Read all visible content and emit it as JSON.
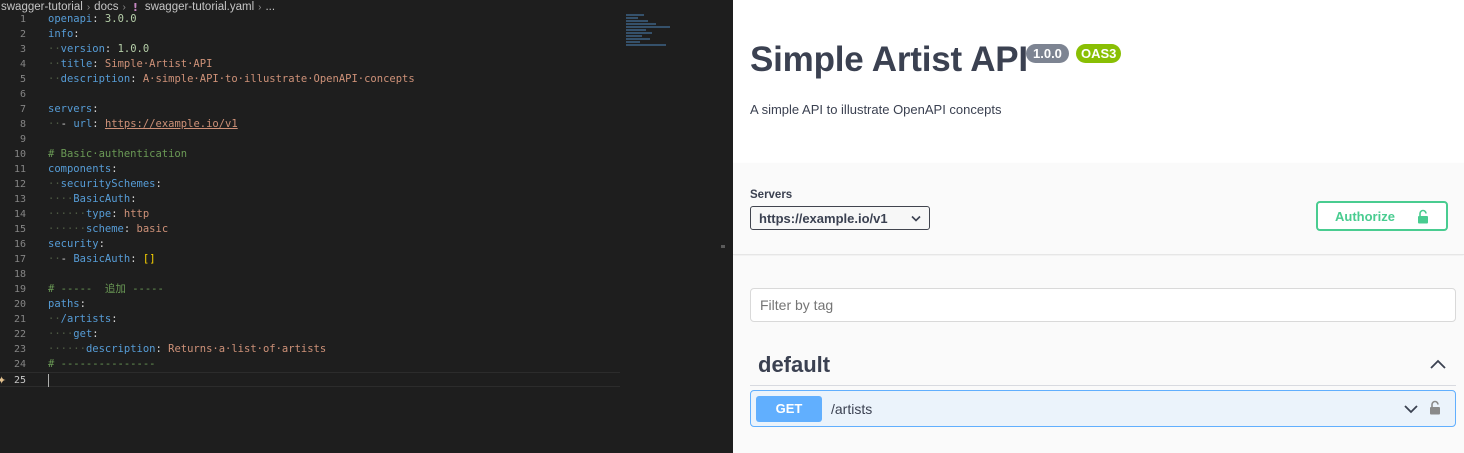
{
  "breadcrumb": [
    "swagger-tutorial",
    "docs",
    "swagger-tutorial.yaml",
    "..."
  ],
  "editor": {
    "lines": [
      {
        "n": "1",
        "segs": [
          [
            "k",
            "openapi"
          ],
          [
            "p",
            ": "
          ],
          [
            "n",
            "3.0.0"
          ]
        ]
      },
      {
        "n": "2",
        "segs": [
          [
            "k",
            "info"
          ],
          [
            "p",
            ":"
          ]
        ]
      },
      {
        "n": "3",
        "segs": [
          [
            "ws",
            "··"
          ],
          [
            "k",
            "version"
          ],
          [
            "p",
            ": "
          ],
          [
            "n",
            "1.0.0"
          ]
        ]
      },
      {
        "n": "4",
        "segs": [
          [
            "ws",
            "··"
          ],
          [
            "k",
            "title"
          ],
          [
            "p",
            ": "
          ],
          [
            "s",
            "Simple·Artist·API"
          ]
        ]
      },
      {
        "n": "5",
        "segs": [
          [
            "ws",
            "··"
          ],
          [
            "k",
            "description"
          ],
          [
            "p",
            ": "
          ],
          [
            "s",
            "A·simple·API·to·illustrate·OpenAPI·concepts"
          ]
        ]
      },
      {
        "n": "6",
        "segs": []
      },
      {
        "n": "7",
        "segs": [
          [
            "k",
            "servers"
          ],
          [
            "p",
            ":"
          ]
        ]
      },
      {
        "n": "8",
        "segs": [
          [
            "ws",
            "··"
          ],
          [
            "p",
            "- "
          ],
          [
            "k",
            "url"
          ],
          [
            "p",
            ": "
          ],
          [
            "u",
            "https://example.io/v1"
          ]
        ]
      },
      {
        "n": "9",
        "segs": []
      },
      {
        "n": "10",
        "segs": [
          [
            "c",
            "# Basic·authentication"
          ]
        ]
      },
      {
        "n": "11",
        "segs": [
          [
            "k",
            "components"
          ],
          [
            "p",
            ":"
          ]
        ]
      },
      {
        "n": "12",
        "segs": [
          [
            "ws",
            "··"
          ],
          [
            "k",
            "securitySchemes"
          ],
          [
            "p",
            ":"
          ]
        ]
      },
      {
        "n": "13",
        "segs": [
          [
            "ws",
            "····"
          ],
          [
            "k",
            "BasicAuth"
          ],
          [
            "p",
            ":"
          ]
        ]
      },
      {
        "n": "14",
        "segs": [
          [
            "ws",
            "······"
          ],
          [
            "k",
            "type"
          ],
          [
            "p",
            ": "
          ],
          [
            "s",
            "http"
          ]
        ]
      },
      {
        "n": "15",
        "segs": [
          [
            "ws",
            "······"
          ],
          [
            "k",
            "scheme"
          ],
          [
            "p",
            ": "
          ],
          [
            "s",
            "basic"
          ]
        ]
      },
      {
        "n": "16",
        "segs": [
          [
            "k",
            "security"
          ],
          [
            "p",
            ":"
          ]
        ]
      },
      {
        "n": "17",
        "segs": [
          [
            "ws",
            "··"
          ],
          [
            "p",
            "- "
          ],
          [
            "k",
            "BasicAuth"
          ],
          [
            "p",
            ": "
          ],
          [
            "br",
            "[]"
          ]
        ]
      },
      {
        "n": "18",
        "segs": []
      },
      {
        "n": "19",
        "segs": [
          [
            "c",
            "# -----  追加 -----"
          ]
        ]
      },
      {
        "n": "20",
        "segs": [
          [
            "k",
            "paths"
          ],
          [
            "p",
            ":"
          ]
        ]
      },
      {
        "n": "21",
        "segs": [
          [
            "ws",
            "··"
          ],
          [
            "k",
            "/artists"
          ],
          [
            "p",
            ":"
          ]
        ]
      },
      {
        "n": "22",
        "segs": [
          [
            "ws",
            "····"
          ],
          [
            "k",
            "get"
          ],
          [
            "p",
            ":"
          ]
        ]
      },
      {
        "n": "23",
        "segs": [
          [
            "ws",
            "······"
          ],
          [
            "k",
            "description"
          ],
          [
            "p",
            ": "
          ],
          [
            "s",
            "Returns·a·list·of·artists"
          ]
        ]
      },
      {
        "n": "24",
        "segs": [
          [
            "c",
            "# ---------------"
          ]
        ]
      },
      {
        "n": "25",
        "segs": [],
        "active": true
      }
    ]
  },
  "swagger": {
    "title": "Simple Artist API",
    "version": "1.0.0",
    "oas_badge": "OAS3",
    "description": "A simple API to illustrate OpenAPI concepts",
    "servers_label": "Servers",
    "server_selected": "https://example.io/v1",
    "authorize_label": "Authorize",
    "filter_placeholder": "Filter by tag",
    "tag_name": "default",
    "operation": {
      "method": "GET",
      "path": "/artists"
    }
  },
  "colors": {
    "get": "#61affe",
    "authorize": "#49cc90",
    "oas": "#89bf04",
    "version": "#7d8492"
  },
  "icons": {
    "yaml_file": "exclamation-icon",
    "server_chevron": "chevron-down-icon",
    "authorize_lock": "lock-icon",
    "tag_toggle": "chevron-up-icon",
    "op_chevron": "chevron-down-icon",
    "op_lock": "lock-icon"
  }
}
